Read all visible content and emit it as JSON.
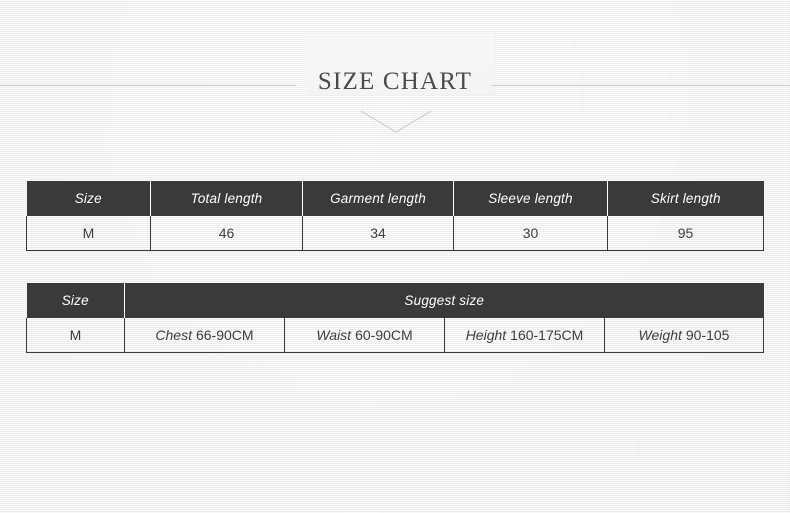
{
  "header": {
    "title": "SIZE CHART",
    "divider_icon": "chevron-down-icon",
    "rule_color": "#c9c9c9"
  },
  "theme": {
    "header_bg": "#3a3a3a",
    "header_text": "#ffffff",
    "body_text": "#3e3e3e",
    "page_bg": "#f2f2f2",
    "border": "#3a3a3a"
  },
  "tables": {
    "measurements": {
      "columns": [
        "Size",
        "Total length",
        "Garment length",
        "Sleeve length",
        "Skirt length"
      ],
      "rows": [
        {
          "size": "M",
          "total_length": "46",
          "garment_length": "34",
          "sleeve_length": "30",
          "skirt_length": "95"
        }
      ]
    },
    "suggest": {
      "columns": [
        "Size",
        "Suggest size"
      ],
      "rows": [
        {
          "size": "M",
          "chest_label": "Chest",
          "chest_value": "66-90CM",
          "waist_label": "Waist",
          "waist_value": "60-90CM",
          "height_label": "Height",
          "height_value": "160-175CM",
          "weight_label": "Weight",
          "weight_value": "90-105"
        }
      ]
    }
  }
}
